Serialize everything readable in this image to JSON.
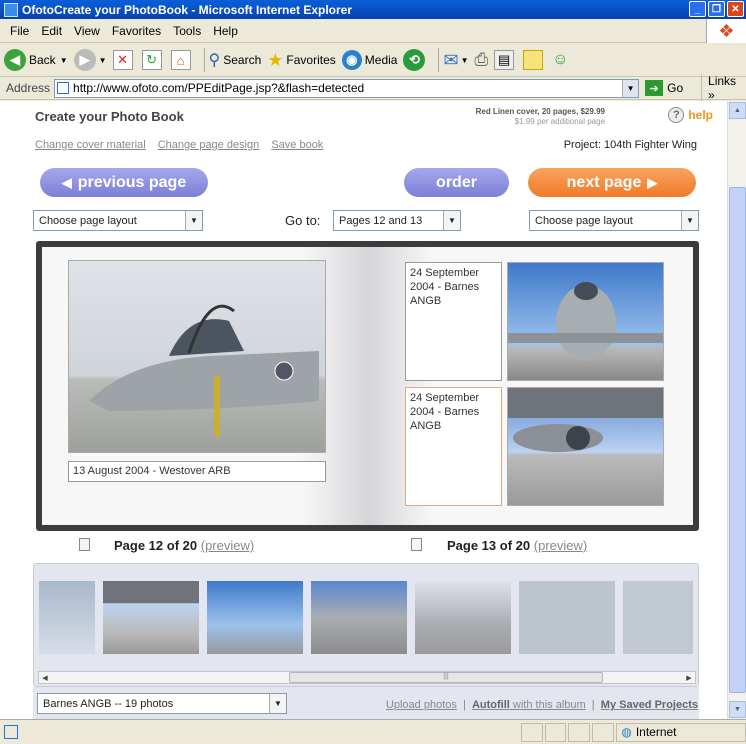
{
  "window": {
    "title": "OfotoCreate your PhotoBook - Microsoft Internet Explorer"
  },
  "menu": [
    "File",
    "Edit",
    "View",
    "Favorites",
    "Tools",
    "Help"
  ],
  "toolbar": {
    "back": "Back",
    "search": "Search",
    "favorites": "Favorites",
    "media": "Media"
  },
  "address": {
    "label": "Address",
    "url": "http://www.ofoto.com/PPEditPage.jsp?&flash=detected",
    "go": "Go",
    "links": "Links"
  },
  "page": {
    "title": "Create your Photo Book",
    "cover_info": "Red Linen cover, 20 pages, $29.99",
    "cover_sub": "$1.99 per additional page",
    "help": "help",
    "link_cover": "Change cover material",
    "link_design": "Change page design",
    "link_save": "Save book",
    "project": "Project: 104th Fighter Wing",
    "prev_btn": "previous page",
    "order_btn": "order",
    "next_btn": "next page",
    "layout_left": "Choose page layout",
    "goto_label": "Go to:",
    "goto_value": "Pages 12 and 13",
    "layout_right": "Choose page layout",
    "caption_left": "13 August 2004 - Westover ARB",
    "caption_r1": "24 September 2004 - Barnes ANGB",
    "caption_r2": "24 September 2004 - Barnes ANGB",
    "page_left": "Page 12 of 20",
    "page_right": "Page 13 of 20",
    "preview": "(preview)",
    "album": "Barnes ANGB -- 19 photos",
    "upload": "Upload photos",
    "autofill": "Autofill",
    "autofill_rest": "with this album",
    "saved": "My Saved Projects"
  },
  "status": {
    "zone": "Internet"
  },
  "colors": {
    "accent_purple": "#8a8de0",
    "accent_orange": "#f28a3a"
  }
}
